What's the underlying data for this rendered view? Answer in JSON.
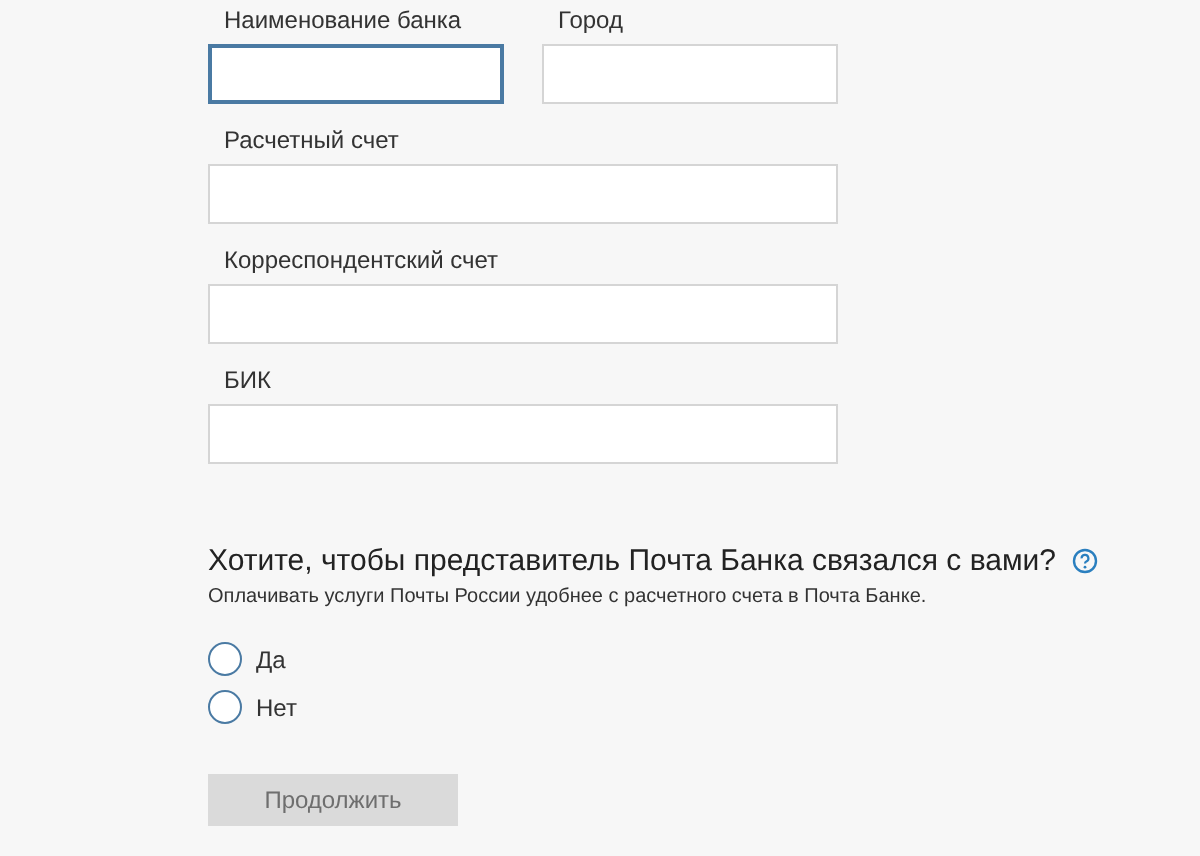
{
  "form": {
    "rows": [
      {
        "fields": [
          {
            "label": "Наименование банка",
            "focused": true
          },
          {
            "label": "Город",
            "focused": false
          }
        ]
      },
      {
        "fields": [
          {
            "label": "Расчетный счет",
            "focused": false
          }
        ]
      },
      {
        "fields": [
          {
            "label": "Корреспондентский счет",
            "focused": false
          }
        ]
      },
      {
        "fields": [
          {
            "label": "БИК",
            "focused": false
          }
        ]
      }
    ]
  },
  "question": {
    "title": "Хотите, чтобы представитель Почта Банка связался с вами?",
    "subtitle": "Оплачивать услуги Почты России удобнее с расчетного счета в Почта Банке.",
    "options": [
      {
        "label": "Да",
        "selected": false
      },
      {
        "label": "Нет",
        "selected": false
      }
    ]
  },
  "submit": {
    "label": "Продолжить",
    "disabled": true
  }
}
